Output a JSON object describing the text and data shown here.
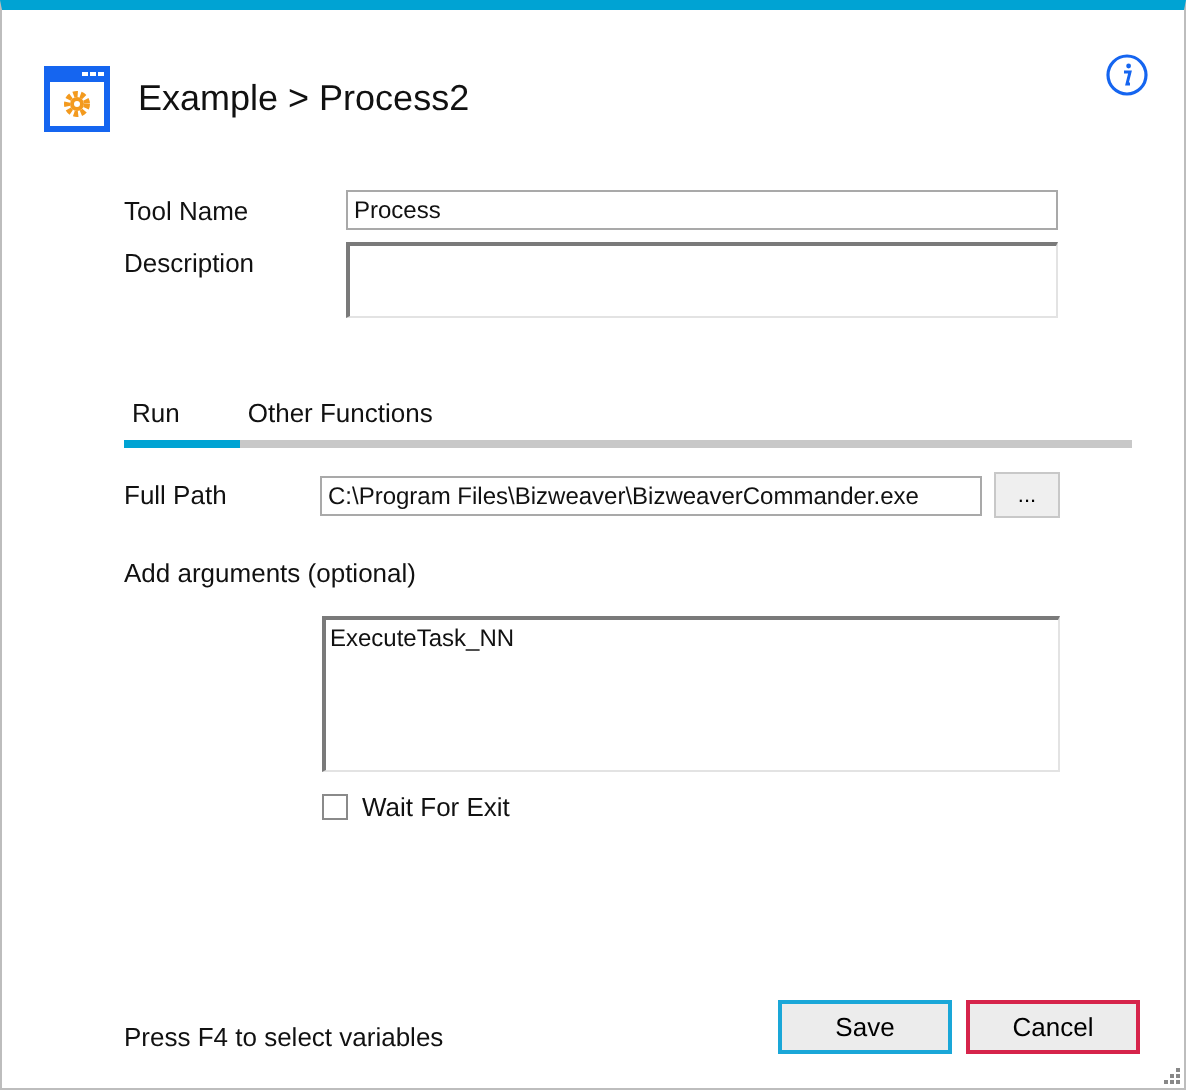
{
  "window": {
    "title": "Example > Process2"
  },
  "fields": [
    {
      "label": "Tool Name",
      "value": "Process",
      "kind": "line"
    },
    {
      "label": "Description",
      "kind": "area"
    }
  ],
  "tabs": [
    {
      "label": "Run",
      "selected": true
    },
    {
      "label": "Other Functions",
      "selected": false
    }
  ],
  "full_path": {
    "label": "Full Path",
    "value": "C:\\Program Files\\Bizweaver\\BizweaverCommander.exe",
    "browse_button": "..."
  },
  "arguments": {
    "label": "Add arguments (optional)",
    "value": "ExecuteTask_NN"
  },
  "wait_for_exit": {
    "label": "Wait For Exit",
    "checked": false
  },
  "hint": "Press F4 to select variables",
  "buttons": [
    {
      "label": "Save",
      "kind": "primary"
    },
    {
      "label": "Cancel",
      "kind": "cancel"
    }
  ]
}
